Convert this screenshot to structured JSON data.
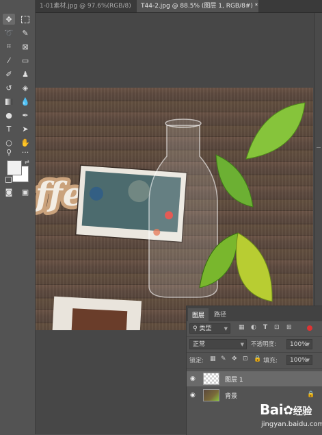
{
  "tabs": [
    {
      "label": "1-01素材.jpg @ 97.6%(RGB/8)",
      "close": "×"
    },
    {
      "label": "T44-2.jpg @ 88.5% (图层 1, RGB/8#) *",
      "close": "×"
    }
  ],
  "canvas_text": "ffee",
  "layers_panel": {
    "tabs": [
      "图层",
      "路径"
    ],
    "filter_label": "类型",
    "blend_mode": "正常",
    "opacity_label": "不透明度:",
    "opacity_value": "100%",
    "lock_label": "锁定:",
    "fill_label": "填充:",
    "fill_value": "100%",
    "layers": [
      {
        "name": "图层 1",
        "selected": true
      },
      {
        "name": "背景",
        "selected": false
      }
    ]
  },
  "watermark": {
    "brand": "Bai",
    "brand2": "经验",
    "url": "jingyan.baidu.com"
  },
  "colors": {
    "accent": "#3c7fd9",
    "panel": "#535353",
    "wood": "#5a483c",
    "leaf": "#7dbb2a"
  }
}
